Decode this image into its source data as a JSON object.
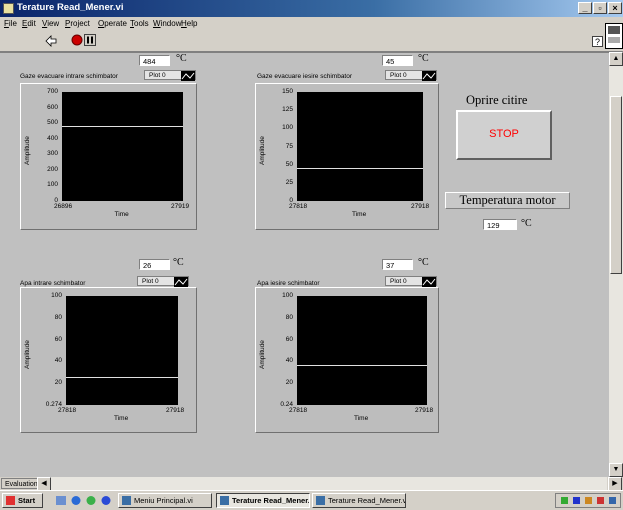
{
  "window": {
    "title": "Terature Read_Mener.vi"
  },
  "menu": [
    "File",
    "Edit",
    "View",
    "Project",
    "Operate",
    "Tools",
    "Window",
    "Help"
  ],
  "graphs": [
    {
      "label": "Gaze evacuare intrare schimbator",
      "value": "484",
      "unit": "°C",
      "plot": "Plot 0",
      "yticks": [
        "700",
        "600",
        "500",
        "400",
        "300",
        "200",
        "100",
        "0"
      ],
      "xmin": "26896",
      "xmax": "27919",
      "xlabel": "Time",
      "ylabel": "Amplitude",
      "trace_level": 484,
      "ymin": 0,
      "ymax": 700
    },
    {
      "label": "Gaze evacuare iesire schimbator",
      "value": "45",
      "unit": "°C",
      "plot": "Plot 0",
      "yticks": [
        "150",
        "125",
        "100",
        "75",
        "50",
        "25",
        "0"
      ],
      "xmin": "27818",
      "xmax": "27918",
      "xlabel": "Time",
      "ylabel": "Amplitude",
      "trace_level": 45,
      "ymin": 0,
      "ymax": 150
    },
    {
      "label": "Apa intrare schimbator",
      "value": "26",
      "unit": "°C",
      "plot": "Plot 0",
      "yticks": [
        "100",
        "80",
        "60",
        "40",
        "20",
        "0.274"
      ],
      "xmin": "27818",
      "xmax": "27918",
      "xlabel": "Time",
      "ylabel": "Amplitude",
      "trace_level": 26,
      "ymin": 0.274,
      "ymax": 100
    },
    {
      "label": "Apa iesire schimbator",
      "value": "37",
      "unit": "°C",
      "plot": "Plot 0",
      "yticks": [
        "100",
        "80",
        "60",
        "40",
        "20",
        "0.24"
      ],
      "xmin": "27818",
      "xmax": "27918",
      "xlabel": "Time",
      "ylabel": "Amplitude",
      "trace_level": 37,
      "ymin": 0.24,
      "ymax": 100
    }
  ],
  "stop": {
    "title": "Oprire citire",
    "label": "STOP",
    "color": "#ff0000"
  },
  "motor": {
    "title": "Temperatura motor",
    "value": "129",
    "unit": "°C"
  },
  "status": {
    "mode": "Evaluation"
  },
  "taskbar": {
    "start": "Start",
    "items": [
      "Meniu Principal.vi",
      "Terature Read_Mener...",
      "Terature Read_Mener.vi ..."
    ]
  }
}
